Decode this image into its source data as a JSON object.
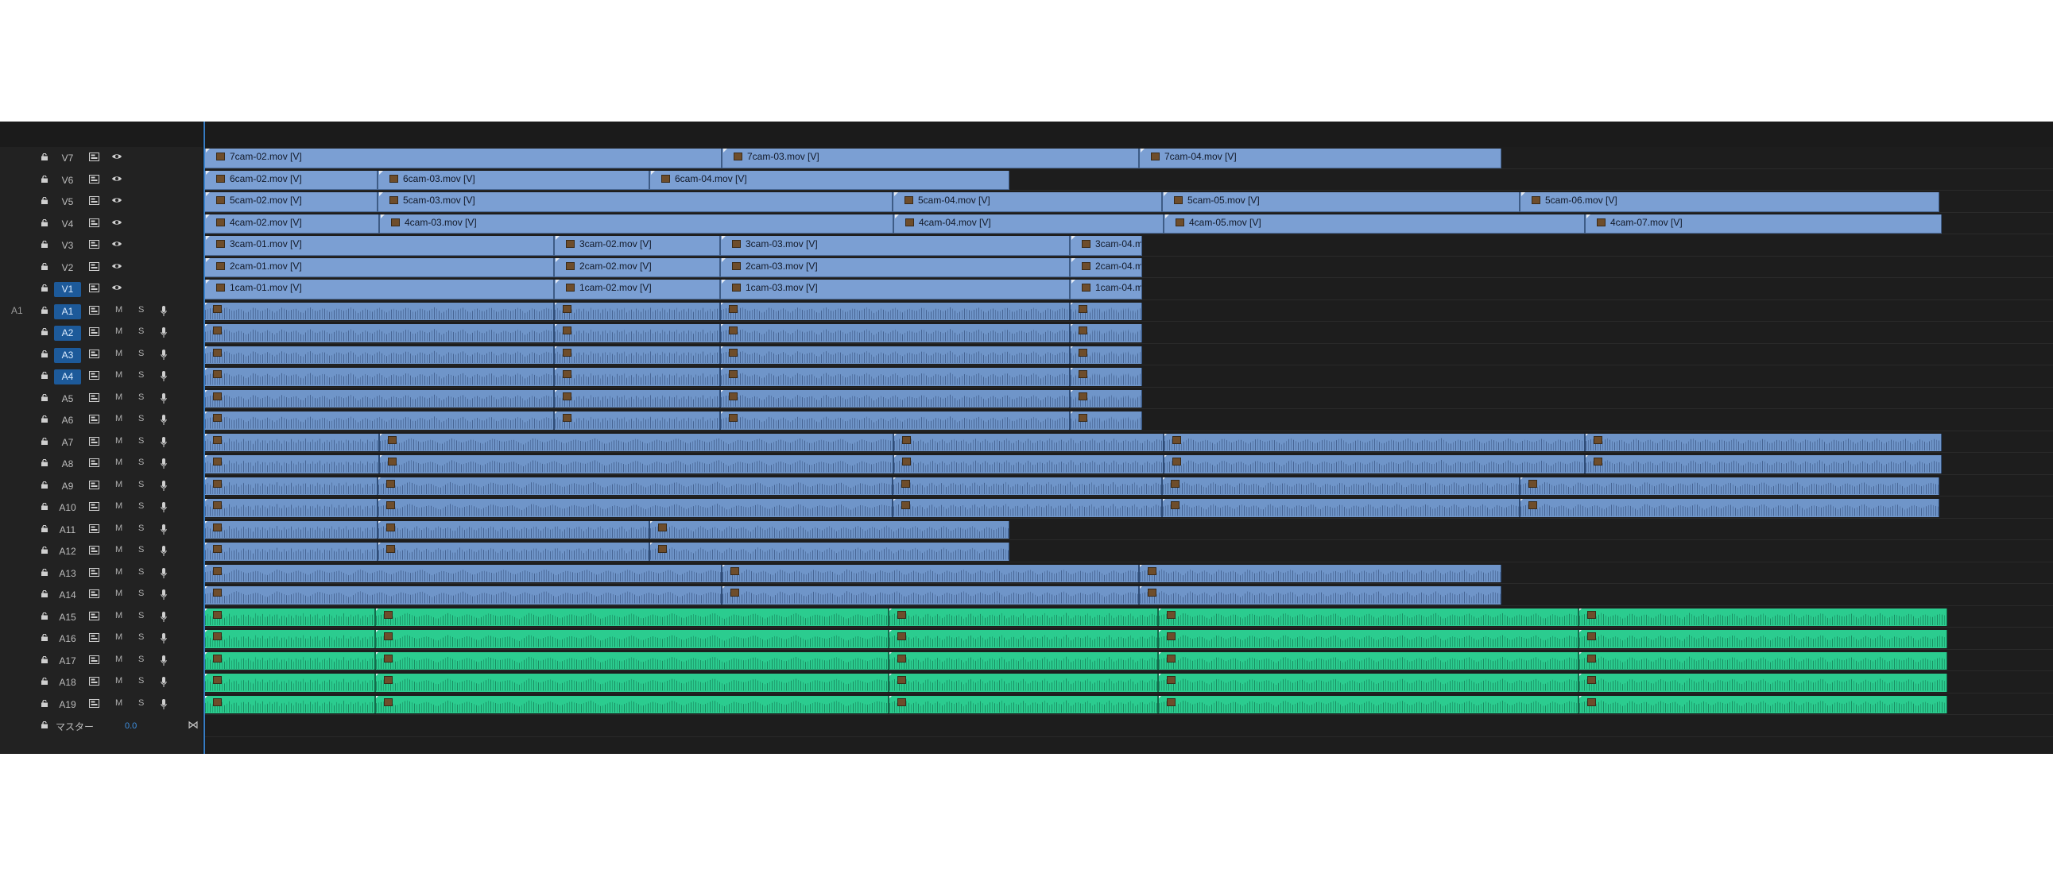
{
  "colors": {
    "video_clip": "#7b9fd3",
    "audio_clip": "#6f95c9",
    "music_clip": "#2bcc8f",
    "track_on": "#1d5a9a",
    "playhead": "#3c8de0"
  },
  "icons": {
    "lock": "lock-icon",
    "sync": "sync-lock-icon",
    "eye": "eye-icon",
    "mic": "mic-icon"
  },
  "labels": {
    "mute": "M",
    "solo": "S"
  },
  "source_patch": "A1",
  "master": {
    "label": "マスター",
    "value": "0.0"
  },
  "video_tracks": [
    {
      "name": "V7",
      "targeted": false,
      "clips": [
        {
          "label": "7cam-02.mov [V]"
        },
        {
          "label": "7cam-03.mov [V]"
        },
        {
          "label": "7cam-04.mov [V]"
        }
      ]
    },
    {
      "name": "V6",
      "targeted": false,
      "clips": [
        {
          "label": "6cam-02.mov [V]"
        },
        {
          "label": "6cam-03.mov [V]"
        },
        {
          "label": "6cam-04.mov [V]"
        }
      ]
    },
    {
      "name": "V5",
      "targeted": false,
      "clips": [
        {
          "label": "5cam-02.mov [V]"
        },
        {
          "label": "5cam-03.mov [V]"
        },
        {
          "label": "5cam-04.mov [V]"
        },
        {
          "label": "5cam-05.mov [V]"
        },
        {
          "label": "5cam-06.mov [V]"
        }
      ]
    },
    {
      "name": "V4",
      "targeted": false,
      "clips": [
        {
          "label": "4cam-02.mov [V]"
        },
        {
          "label": "4cam-03.mov [V]"
        },
        {
          "label": "4cam-04.mov [V]"
        },
        {
          "label": "4cam-05.mov [V]"
        },
        {
          "label": "4cam-07.mov [V]"
        }
      ]
    },
    {
      "name": "V3",
      "targeted": false,
      "clips": [
        {
          "label": "3cam-01.mov [V]"
        },
        {
          "label": "3cam-02.mov [V]"
        },
        {
          "label": "3cam-03.mov [V]"
        },
        {
          "label": "3cam-04.m"
        }
      ]
    },
    {
      "name": "V2",
      "targeted": false,
      "clips": [
        {
          "label": "2cam-01.mov [V]"
        },
        {
          "label": "2cam-02.mov [V]"
        },
        {
          "label": "2cam-03.mov [V]"
        },
        {
          "label": "2cam-04.m"
        }
      ]
    },
    {
      "name": "V1",
      "targeted": true,
      "clips": [
        {
          "label": "1cam-01.mov [V]"
        },
        {
          "label": "1cam-02.mov [V]"
        },
        {
          "label": "1cam-03.mov [V]"
        },
        {
          "label": "1cam-04.m"
        }
      ]
    }
  ],
  "audio_tracks": [
    {
      "name": "A1",
      "targeted": true
    },
    {
      "name": "A2",
      "targeted": true
    },
    {
      "name": "A3",
      "targeted": true
    },
    {
      "name": "A4",
      "targeted": true
    },
    {
      "name": "A5",
      "targeted": false
    },
    {
      "name": "A6",
      "targeted": false
    },
    {
      "name": "A7",
      "targeted": false
    },
    {
      "name": "A8",
      "targeted": false
    },
    {
      "name": "A9",
      "targeted": false
    },
    {
      "name": "A10",
      "targeted": false
    },
    {
      "name": "A11",
      "targeted": false
    },
    {
      "name": "A12",
      "targeted": false
    },
    {
      "name": "A13",
      "targeted": false
    },
    {
      "name": "A14",
      "targeted": false
    },
    {
      "name": "A15",
      "targeted": false
    },
    {
      "name": "A16",
      "targeted": false
    },
    {
      "name": "A17",
      "targeted": false
    },
    {
      "name": "A18",
      "targeted": false
    },
    {
      "name": "A19",
      "targeted": false
    }
  ]
}
